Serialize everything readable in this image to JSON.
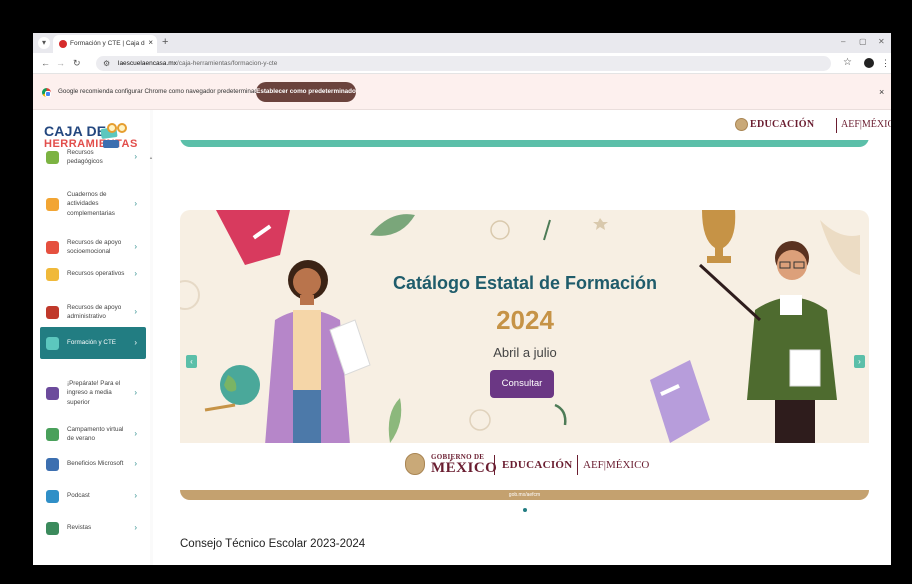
{
  "browser": {
    "tab_title": "Formación y CTE | Caja de herra",
    "tab_close": "×",
    "new_tab": "+",
    "url_host": "laescuelaencasa.mx",
    "url_path": "/caja-herramientas/formacion-y-cte",
    "minimize": "–",
    "restore": "▢",
    "close": "✕"
  },
  "infobar": {
    "message": "Google recomienda configurar Chrome como navegador predeterminado",
    "button": "Establecer como predeterminado",
    "close": "×"
  },
  "sidebar": {
    "logo_line1": "CAJA DE",
    "logo_line2": "HERRAMIENTAS",
    "items": [
      {
        "label": "Recursos pedagógicos",
        "color": "#7cb342"
      },
      {
        "label": "Cuadernos de actividades complementarias",
        "color": "#f2a533"
      },
      {
        "label": "Recursos de apoyo socioemocional",
        "color": "#e5503f"
      },
      {
        "label": "Recursos operativos",
        "color": "#f0b93a"
      },
      {
        "label": "Recursos de apoyo administrativo",
        "color": "#c0392b"
      },
      {
        "label": "Formación y CTE",
        "color": "#5cc7be"
      },
      {
        "label": "¡Prepárate! Para el ingreso a media superior",
        "color": "#6c4b9c"
      },
      {
        "label": "Campamento virtual de verano",
        "color": "#49a05b"
      },
      {
        "label": "Beneficios Microsoft",
        "color": "#3c6fb0"
      },
      {
        "label": "Podcast",
        "color": "#2f8fc7"
      },
      {
        "label": "Revistas",
        "color": "#3b8a5c"
      }
    ],
    "chevron": "›"
  },
  "header": {
    "education": "EDUCACIÓN",
    "aef": "AEF|MÉXICO"
  },
  "hero": {
    "title": "Catálogo Estatal de Formación",
    "year": "2024",
    "subtitle": "Abril a julio",
    "button": "Consultar",
    "gob_small": "GOBIERNO DE",
    "gob_big": "MÉXICO",
    "education": "EDUCACIÓN",
    "aef": "AEF|MÉXICO",
    "url": "gob.mx/aefcm",
    "next": "›",
    "prev": "‹"
  },
  "section_title": "Consejo Técnico Escolar 2023-2024",
  "colors": {
    "accent_teal": "#227d82",
    "banner_teal": "#5bbfa9",
    "button_purple": "#6b3784",
    "gov_maroon": "#6a1d30"
  }
}
